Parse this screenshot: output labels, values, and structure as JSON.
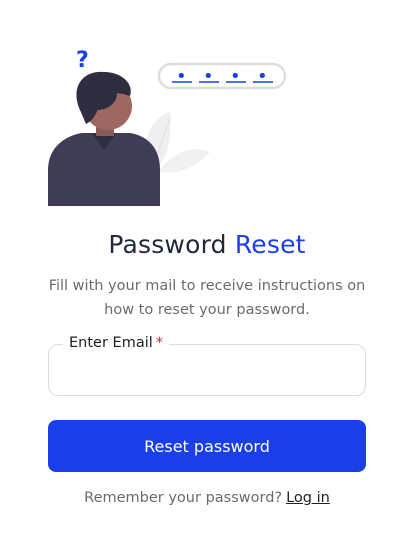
{
  "illustration": {
    "question_mark": "?",
    "password_mask": [
      "•",
      "•",
      "•",
      "•"
    ]
  },
  "header": {
    "title_prefix": "Password",
    "title_accent": "Reset",
    "subtitle": "Fill with your mail to receive instructions on how to reset your password."
  },
  "form": {
    "email_label": "Enter Email",
    "required_mark": "*",
    "email_value": "",
    "submit_label": "Reset password"
  },
  "footer": {
    "prompt": "Remember your password?",
    "login_link": "Log in"
  },
  "colors": {
    "accent": "#1a3ee8",
    "required": "#e02424"
  }
}
